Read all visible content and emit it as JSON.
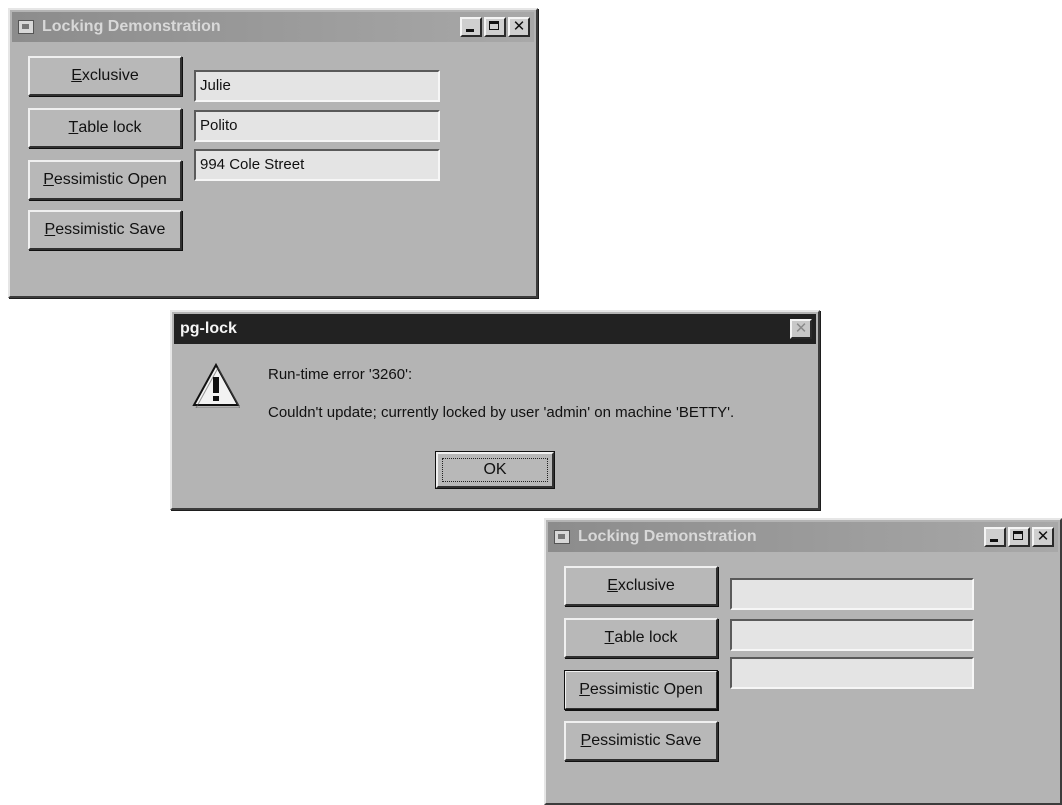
{
  "window_top": {
    "title": "Locking Demonstration",
    "buttons": {
      "exclusive": {
        "pre": "",
        "key": "E",
        "post": "xclusive"
      },
      "table_lock": {
        "pre": "",
        "key": "T",
        "post": "able lock"
      },
      "pessimistic_open": {
        "pre": "",
        "key": "P",
        "post": "essimistic Open"
      },
      "pessimistic_save": {
        "pre": "",
        "key": "P",
        "post": "essimistic Save"
      }
    },
    "fields": {
      "first_name": "Julie",
      "last_name": "Polito",
      "address": "994 Cole Street"
    }
  },
  "dialog": {
    "title": "pg-lock",
    "icon": "warning-icon",
    "error_line": "Run-time error '3260':",
    "message": "Couldn't update; currently locked by user 'admin' on machine 'BETTY'.",
    "ok_label": "OK"
  },
  "window_bottom": {
    "title": "Locking Demonstration",
    "buttons": {
      "exclusive": {
        "pre": "",
        "key": "E",
        "post": "xclusive"
      },
      "table_lock": {
        "pre": "",
        "key": "T",
        "post": "able lock"
      },
      "pessimistic_open": {
        "pre": "",
        "key": "P",
        "post": "essimistic Open"
      },
      "pessimistic_save": {
        "pre": "",
        "key": "P",
        "post": "essimistic Save"
      }
    },
    "fields": {
      "first_name": "",
      "last_name": "",
      "address": ""
    }
  }
}
